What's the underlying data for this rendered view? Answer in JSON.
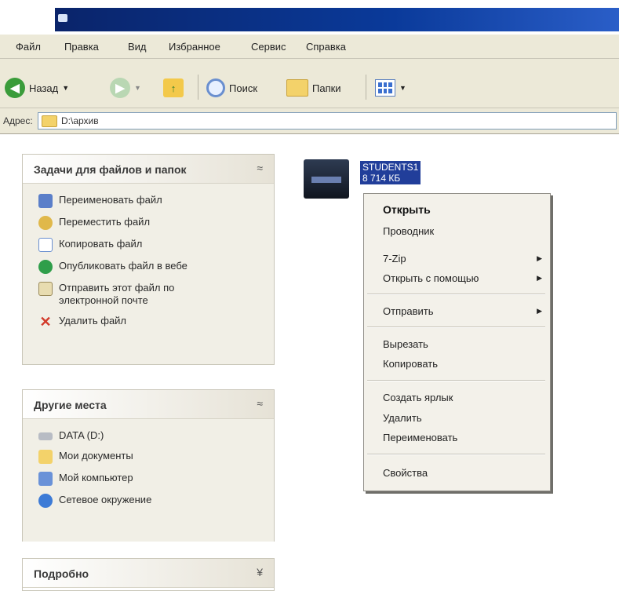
{
  "menubar": {
    "items": [
      "Файл",
      "Правка",
      "Вид",
      "Избранное",
      "Сервис",
      "Справка"
    ]
  },
  "toolbar": {
    "back_label": "Назад",
    "search_label": "Поиск",
    "folders_label": "Папки"
  },
  "address": {
    "label": "Адрес:",
    "path": "D:\\архив"
  },
  "tasks_panel": {
    "title": "Задачи для файлов и папок",
    "items": [
      "Переименовать файл",
      "Переместить файл",
      "Копировать файл",
      "Опубликовать файл в вебе",
      "Отправить этот файл по электронной почте",
      "Удалить файл"
    ]
  },
  "places_panel": {
    "title": "Другие места",
    "items": [
      "DATA (D:)",
      "Мои документы",
      "Мой компьютер",
      "Сетевое окружение"
    ]
  },
  "details_panel": {
    "title": "Подробно"
  },
  "file": {
    "name": "STUDENTS1",
    "size": "8 714 КБ"
  },
  "context_menu": {
    "open": "Открыть",
    "explorer": "Проводник",
    "sevenzip": "7-Zip",
    "open_with": "Открыть с помощью",
    "send_to": "Отправить",
    "cut": "Вырезать",
    "copy": "Копировать",
    "create_shortcut": "Создать ярлык",
    "delete": "Удалить",
    "rename": "Переименовать",
    "properties": "Свойства"
  },
  "icons": {
    "back": "back-arrow-icon",
    "forward": "forward-arrow-icon",
    "up": "up-folder-icon",
    "search": "search-icon",
    "folders": "folders-icon",
    "views": "views-icon"
  },
  "colors": {
    "titlebar": "#0a246a",
    "selection": "#213e9a",
    "toolbar_bg": "#ece9d8"
  }
}
